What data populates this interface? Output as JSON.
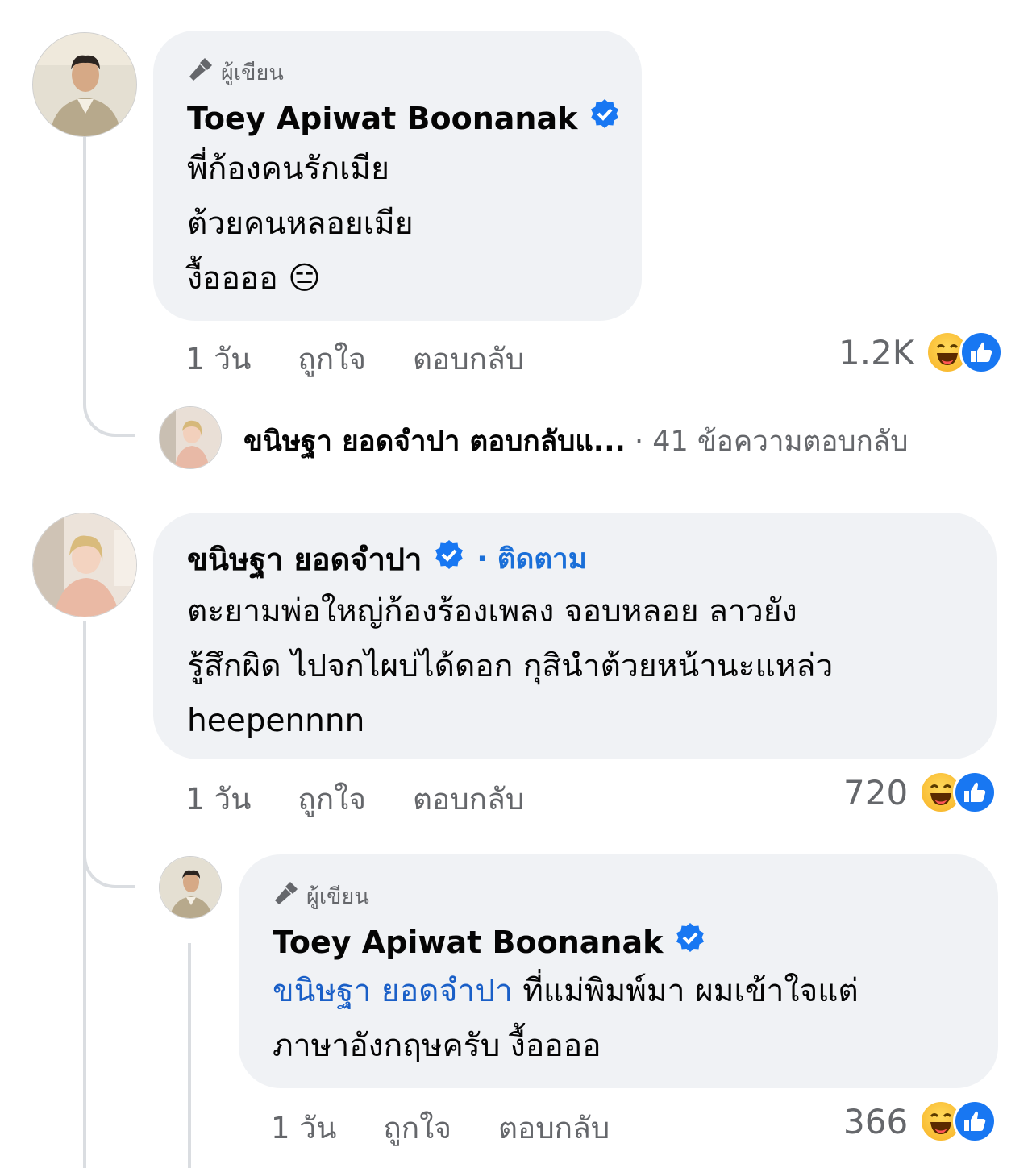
{
  "comment1": {
    "author_tag": "ผู้เขียน",
    "name": "Toey Apiwat Boonanak",
    "lines": [
      "พี่ก้องคนรักเมีย",
      "ต้วยคนหลอยเมีย",
      "งื้ออออ 😑"
    ],
    "time": "1 วัน",
    "like": "ถูกใจ",
    "reply": "ตอบกลับ",
    "reaction_count": "1.2K"
  },
  "reply_summary": {
    "text": "ขนิษฐา ยอดจำปา ตอบกลับแ...",
    "count": "· 41 ข้อความตอบกลับ"
  },
  "comment2": {
    "name": "ขนิษฐา ยอดจำปา",
    "follow": "· ติดตาม",
    "lines": [
      "ตะยามพ่อใหญ่ก้องร้องเพลง จอบหลอย ลาวยัง",
      "รู้สึกผิด ไปจกไผบ่ได้ดอก กุสินำต้วยหน้านะแหล่ว",
      "heepennnn"
    ],
    "time": "1 วัน",
    "like": "ถูกใจ",
    "reply": "ตอบกลับ",
    "reaction_count": "720"
  },
  "comment3": {
    "author_tag": "ผู้เขียน",
    "name": "Toey Apiwat Boonanak",
    "mention": "ขนิษฐา ยอดจำปา",
    "line1_rest": " ที่แม่พิมพ์มา ผมเข้าใจแต่",
    "line2": "ภาษาอังกฤษครับ งื้ออออ",
    "time": "1 วัน",
    "like": "ถูกใจ",
    "reply": "ตอบกลับ",
    "reaction_count": "366"
  },
  "colors": {
    "bubble": "#f0f2f5",
    "verified": "#1877f2",
    "link": "#1a5fc7",
    "meta": "#65676b"
  }
}
